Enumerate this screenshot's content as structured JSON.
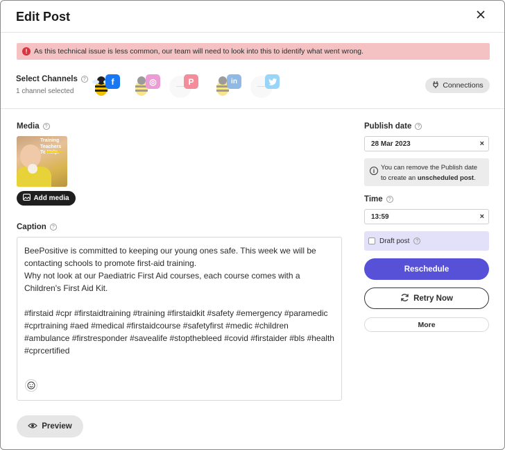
{
  "dialog": {
    "title": "Edit Post",
    "close_icon": "close-icon"
  },
  "alert": {
    "icon": "error-icon",
    "text": "As this technical issue is less common, our team will need to look into this to identify what went wrong.",
    "bg_color": "#f5c2c4"
  },
  "channels": {
    "label": "Select Channels",
    "count_text": "1 channel selected",
    "items": [
      {
        "network": "facebook",
        "selected": true,
        "color": "#1877f2",
        "glyph": "f"
      },
      {
        "network": "instagram",
        "selected": false,
        "color": "#d6249f",
        "glyph": "◎"
      },
      {
        "network": "pinterest",
        "selected": false,
        "color": "#e60023",
        "glyph": "P"
      },
      {
        "network": "linkedin",
        "selected": false,
        "color": "#0a66c2",
        "glyph": "in"
      },
      {
        "network": "twitter",
        "selected": false,
        "color": "#1da1f2",
        "glyph": "🐦"
      }
    ],
    "connections_label": "Connections"
  },
  "media": {
    "label": "Media",
    "thumbnail_text": "Training Teachers To Help.",
    "add_media_label": "Add media"
  },
  "caption": {
    "label": "Caption",
    "text": "BeePositive is committed to keeping our young ones safe. This week we will be contacting schools to promote first-aid training.\nWhy not look at our Paediatric First Aid courses, each course comes with a Children's First Aid Kit.\n\n#firstaid #cpr #firstaidtraining #training #firstaidkit #safety #emergency #paramedic #cprtraining #aed #medical #firstaidcourse #safetyfirst #medic #children #ambulance #firstresponder #savealife #stopthebleed #covid #firstaider #bls #health #cprcertified"
  },
  "preview_label": "Preview",
  "publish": {
    "date_label": "Publish date",
    "date_value": "28 Mar 2023",
    "info_text_prefix": "You can remove the Publish date to create an ",
    "info_text_bold": "unscheduled post",
    "info_text_suffix": ".",
    "time_label": "Time",
    "time_value": "13:59",
    "draft_label": "Draft post",
    "draft_checked": false
  },
  "actions": {
    "reschedule_label": "Reschedule",
    "retry_label": "Retry Now",
    "more_label": "More",
    "accent_color": "#5751d8"
  }
}
